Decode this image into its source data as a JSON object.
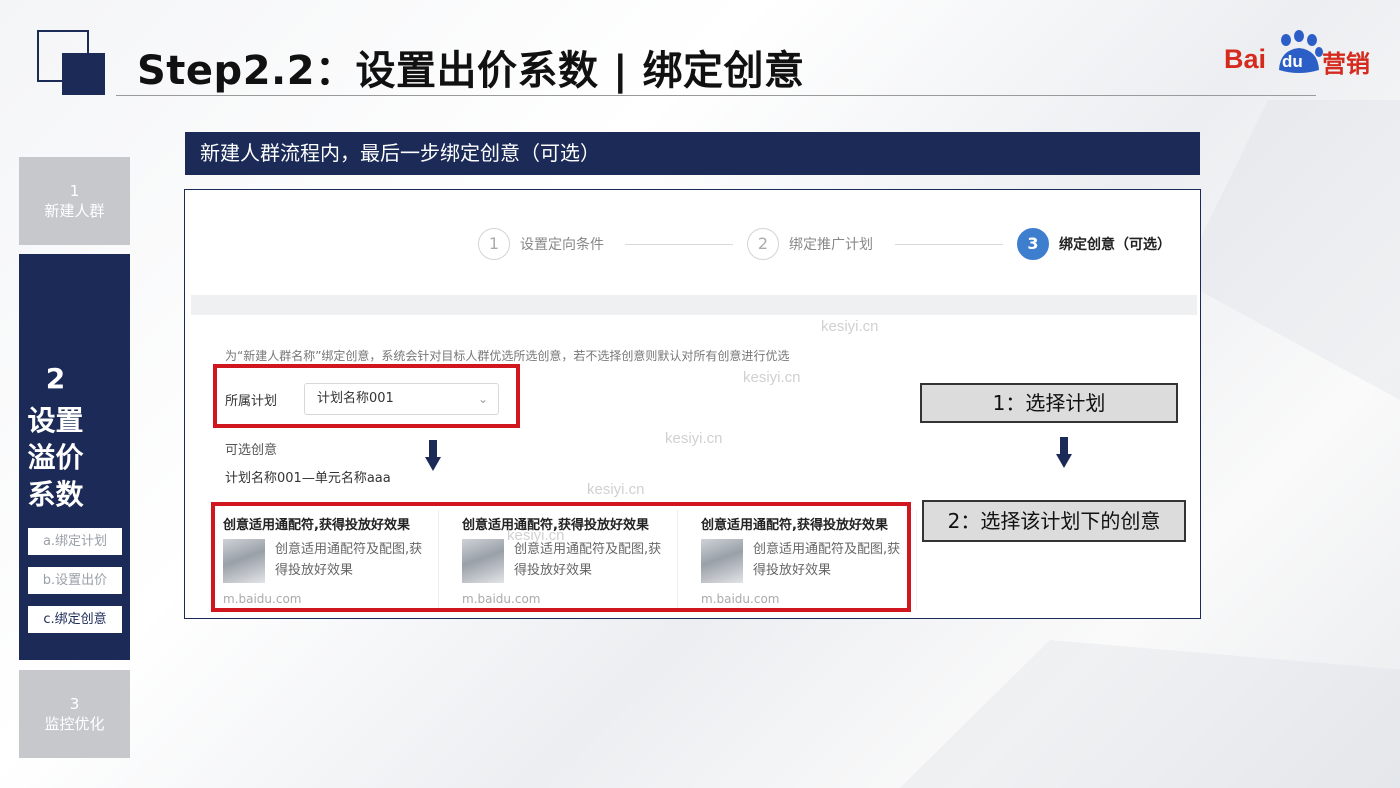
{
  "header": {
    "title": "Step2.2：设置出价系数 |  绑定创意",
    "brand": {
      "bai": "Bai",
      "du": "du",
      "suffix": "营销"
    }
  },
  "nav": {
    "item1": {
      "num": "1",
      "label": "新建人群"
    },
    "item2": {
      "num": "2",
      "label_lines": [
        "设置",
        "溢价",
        "系数"
      ]
    },
    "item3": {
      "num": "3",
      "label": "监控优化"
    },
    "subitems": [
      {
        "label": "a.绑定计划",
        "active": false
      },
      {
        "label": "b.设置出价",
        "active": false
      },
      {
        "label": "c.绑定创意",
        "active": true
      }
    ]
  },
  "banner": {
    "text": "新建人群流程内，最后一步绑定创意（可选）"
  },
  "panel": {
    "steps": [
      {
        "num": "1",
        "label": "设置定向条件",
        "active": false
      },
      {
        "num": "2",
        "label": "绑定推广计划",
        "active": false
      },
      {
        "num": "3",
        "label": "绑定创意（可选）",
        "active": true
      }
    ],
    "description": "为“新建人群名称”绑定创意，系统会针对目标人群优选所选创意，若不选择创意则默认对所有创意进行优选",
    "plan_label": "所属计划",
    "plan_value": "计划名称001",
    "optional_label": "可选创意",
    "unit_label": "计划名称001—单元名称aaa",
    "cards": [
      {
        "title": "创意适用通配符,获得投放好效果",
        "text": "创意适用通配符及配图,获得投放好效果",
        "url": "m.baidu.com"
      },
      {
        "title": "创意适用通配符,获得投放好效果",
        "text": "创意适用通配符及配图,获得投放好效果",
        "url": "m.baidu.com"
      },
      {
        "title": "创意适用通配符,获得投放好效果",
        "text": "创意适用通配符及配图,获得投放好效果",
        "url": "m.baidu.com"
      }
    ],
    "watermark": "kesiyi.cn"
  },
  "callouts": {
    "step1": "1：选择计划",
    "step2": "2：选择该计划下的创意"
  },
  "colors": {
    "navy": "#1b2a56",
    "brand_red": "#d52b1e",
    "highlight_red": "#d0161e",
    "step_active_blue": "#3e7ecf"
  }
}
